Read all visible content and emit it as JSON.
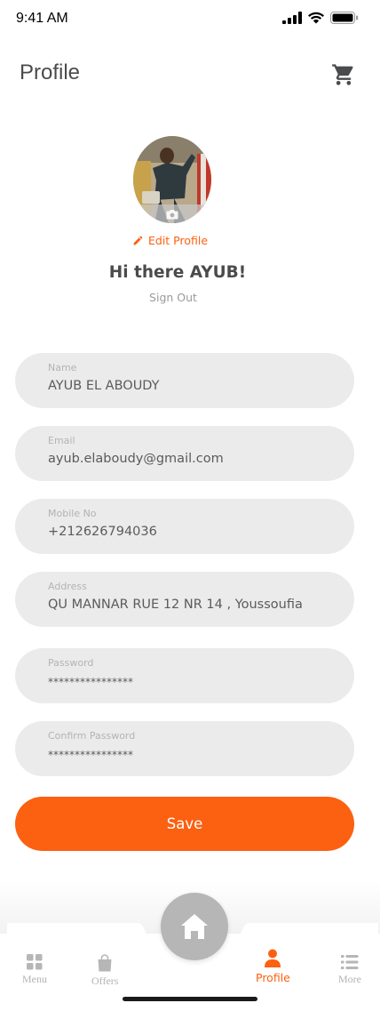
{
  "status_bar": {
    "time": "9:41 AM"
  },
  "header": {
    "title": "Profile",
    "cart_icon": "cart-icon"
  },
  "profile": {
    "edit_label": "Edit Profile",
    "greeting": "Hi there AYUB!",
    "sign_out": "Sign Out"
  },
  "form": {
    "fields": [
      {
        "label": "Name",
        "value": "AYUB EL ABOUDY"
      },
      {
        "label": "Email",
        "value": "ayub.elaboudy@gmail.com"
      },
      {
        "label": "Mobile No",
        "value": "+212626794036"
      },
      {
        "label": "Address",
        "value": "QU MANNAR RUE 12 NR 14 , Youssoufia"
      },
      {
        "label": "Password",
        "value": "****************"
      },
      {
        "label": "Confirm Password",
        "value": "****************"
      }
    ],
    "save_label": "Save"
  },
  "nav": {
    "items": [
      {
        "label": "Menu",
        "icon": "grid-icon"
      },
      {
        "label": "Offers",
        "icon": "bag-icon"
      },
      {
        "label": "Profile",
        "icon": "person-icon"
      },
      {
        "label": "More",
        "icon": "list-icon"
      }
    ],
    "active": "Profile",
    "home_icon": "home-icon"
  },
  "colors": {
    "accent": "#fc6011",
    "field_bg": "#ebebeb",
    "text": "#4a4b4d",
    "muted": "#b3b3b3"
  }
}
